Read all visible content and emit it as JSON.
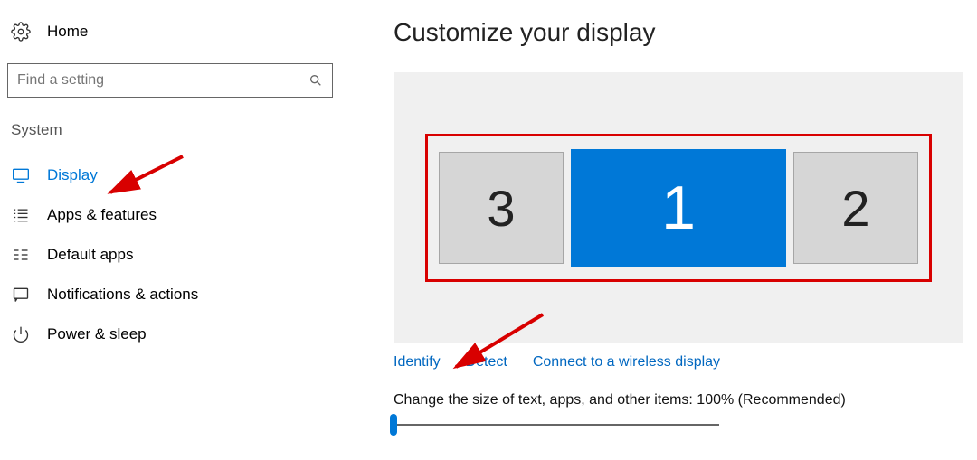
{
  "sidebar": {
    "home_label": "Home",
    "search_placeholder": "Find a setting",
    "section_title": "System",
    "items": [
      {
        "label": "Display",
        "icon": "monitor-icon",
        "active": true
      },
      {
        "label": "Apps & features",
        "icon": "list-icon",
        "active": false
      },
      {
        "label": "Default apps",
        "icon": "defaults-icon",
        "active": false
      },
      {
        "label": "Notifications & actions",
        "icon": "message-icon",
        "active": false
      },
      {
        "label": "Power & sleep",
        "icon": "power-icon",
        "active": false
      }
    ]
  },
  "main": {
    "heading": "Customize your display",
    "monitors": [
      {
        "id": "3",
        "primary": false
      },
      {
        "id": "1",
        "primary": true
      },
      {
        "id": "2",
        "primary": false
      }
    ],
    "links": {
      "identify": "Identify",
      "detect": "Detect",
      "connect": "Connect to a wireless display"
    },
    "scale_label": "Change the size of text, apps, and other items: 100% (Recommended)"
  }
}
